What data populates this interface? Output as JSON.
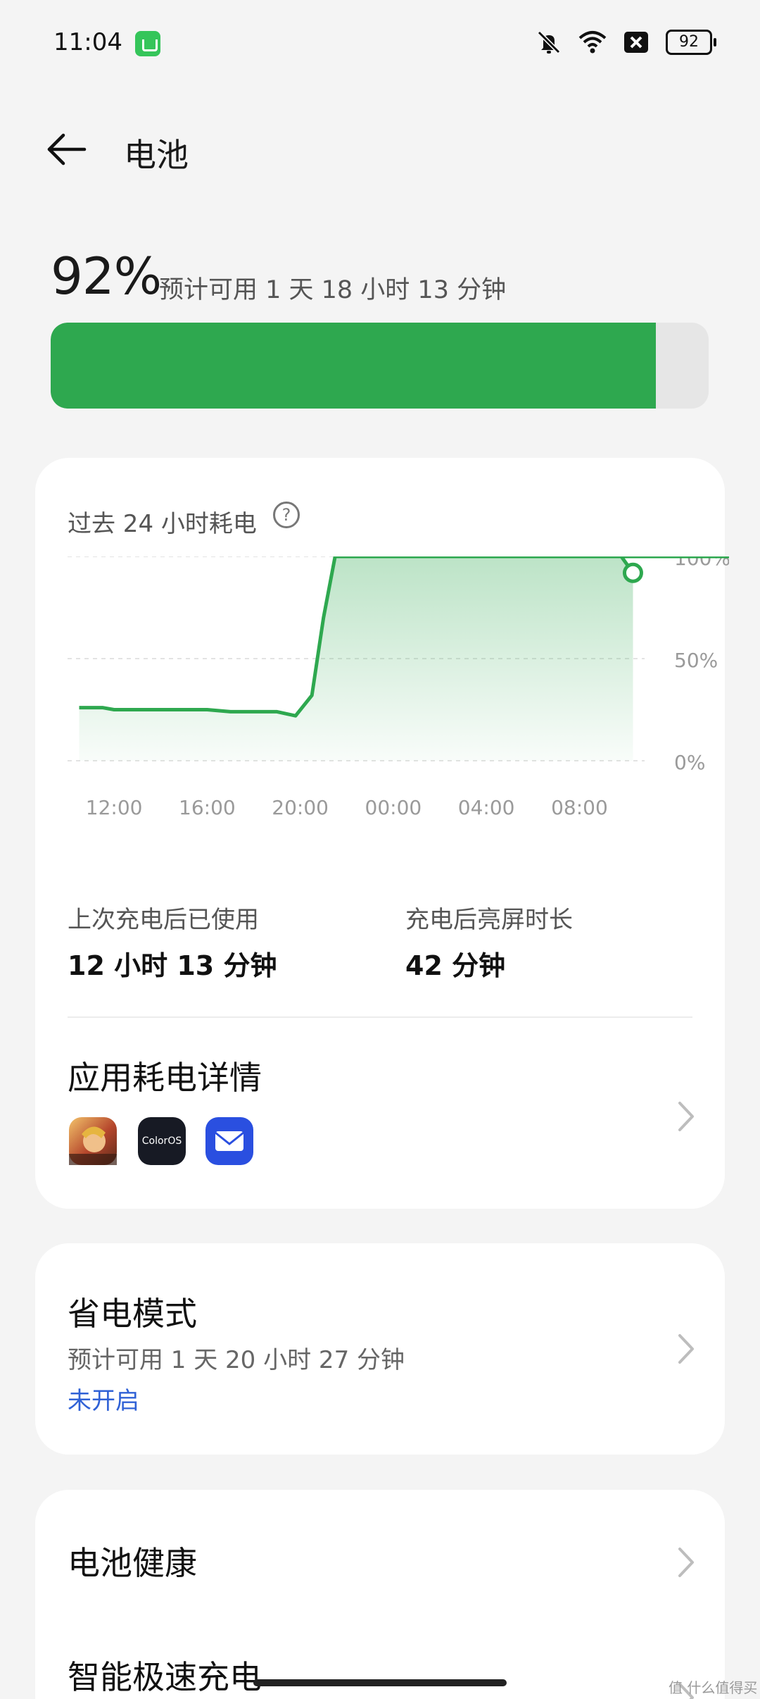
{
  "status_bar": {
    "time": "11:04",
    "battery_level": "92",
    "icons": [
      "notification-app-icon",
      "mute-icon",
      "wifi-icon",
      "close-box-icon",
      "battery-icon"
    ]
  },
  "header": {
    "title": "电池",
    "back_icon": "arrow-left-icon"
  },
  "battery": {
    "percent": "92%",
    "level_fraction": 0.92,
    "estimate": "预计可用 1 天 18 小时 13 分钟",
    "fill_color": "#2ea84f"
  },
  "usage_card": {
    "chart_title": "过去 24 小时耗电",
    "help_icon": "question-circle-icon",
    "stats": [
      {
        "label": "上次充电后已使用",
        "value": "12 小时 13 分钟"
      },
      {
        "label": "充电后亮屏时长",
        "value": "42 分钟"
      }
    ],
    "app_usage_title": "应用耗电详情",
    "apps": [
      {
        "name": "game-app-icon"
      },
      {
        "name": "coloros-app-icon",
        "text": "ColorOS"
      },
      {
        "name": "mail-app-icon"
      }
    ]
  },
  "chart_data": {
    "type": "area",
    "x_ticks": [
      "12:00",
      "16:00",
      "20:00",
      "00:00",
      "04:00",
      "08:00"
    ],
    "y_ticks": [
      "100%",
      "50%",
      "0%"
    ],
    "ylim": [
      0,
      100
    ],
    "grid": true,
    "color": "#2ea84f",
    "x_hours": [
      10.5,
      11.5,
      12,
      13,
      14,
      15,
      16,
      17,
      18,
      19,
      19.8,
      20.5,
      21,
      21.5,
      22,
      24,
      28,
      32,
      36,
      40,
      34,
      34.4
    ],
    "values": [
      26,
      26,
      25,
      25,
      25,
      25,
      25,
      24,
      24,
      24,
      22,
      32,
      70,
      100,
      100,
      100,
      100,
      100,
      100,
      100,
      100,
      92
    ]
  },
  "power_saving": {
    "title": "省电模式",
    "estimate": "预计可用 1 天 20 小时 27 分钟",
    "status": "未开启"
  },
  "more": {
    "battery_health": "电池健康",
    "fast_charge": "智能极速充电"
  },
  "watermark": "值 什么值得买"
}
